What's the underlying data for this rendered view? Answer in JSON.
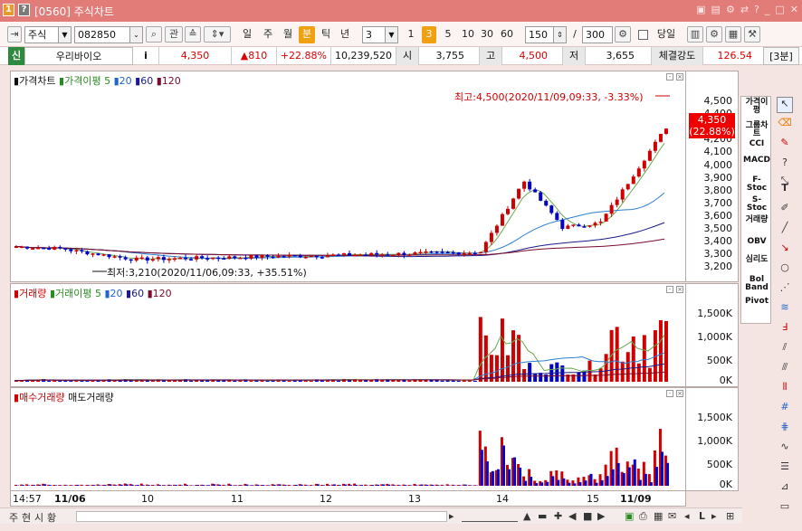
{
  "window": {
    "badge1": "1",
    "badge2": "?",
    "title": "[0560] 주식차트"
  },
  "toolbar": {
    "market_type": "주식",
    "stock_code": "082850",
    "btn_gwan": "관",
    "periods": [
      "일",
      "주",
      "월",
      "분",
      "틱",
      "년"
    ],
    "period_selected": "분",
    "interval_value": "3",
    "intervals": [
      "1",
      "3",
      "5",
      "10",
      "30",
      "60"
    ],
    "interval_selected": "3",
    "count": "150",
    "slash": "/",
    "max_count": "300",
    "today_label": "당일"
  },
  "infobar": {
    "market_badge": "신",
    "stock_name": "우리바이오",
    "info_icon": "i",
    "price": "4,350",
    "change": "▲810",
    "change_pct": "+22.88%",
    "volume": "10,239,520",
    "open_label": "시",
    "open": "3,755",
    "high_label": "고",
    "high": "4,500",
    "low_label": "저",
    "low": "3,655",
    "strength_label": "체결강도",
    "strength": "126.54",
    "interval_badge": "[3분]"
  },
  "price_pane": {
    "legend_title": "가격차트",
    "legend_ma": "가격이평",
    "ma_periods": [
      "5",
      "20",
      "60",
      "120"
    ],
    "high_annotation": "최고:4,500(2020/11/09,09:33, -3.33%)",
    "low_annotation": "최저:3,210(2020/11/06,09:33, +35.51%)",
    "current_price": "4,350",
    "current_pct": "(22.88%)",
    "y_labels": [
      "4,500",
      "4,400",
      "4,300",
      "4,200",
      "4,100",
      "4,000",
      "3,900",
      "3,800",
      "3,700",
      "3,600",
      "3,500",
      "3,400",
      "3,300",
      "3,200"
    ]
  },
  "volume_pane": {
    "legend_title": "거래량",
    "legend_ma": "거래이평",
    "ma_periods": [
      "5",
      "20",
      "60",
      "120"
    ],
    "y_labels": [
      "1,500K",
      "1,000K",
      "500K",
      "0K"
    ]
  },
  "buysell_pane": {
    "legend_buy": "매수거래량",
    "legend_sell": "매도거래량",
    "y_labels": [
      "1,500K",
      "1,000K",
      "500K",
      "0K"
    ]
  },
  "x_axis": {
    "labels": [
      {
        "text": "14:57",
        "bold": false
      },
      {
        "text": "11/06",
        "bold": true
      },
      {
        "text": "10",
        "bold": false
      },
      {
        "text": "11",
        "bold": false
      },
      {
        "text": "12",
        "bold": false
      },
      {
        "text": "13",
        "bold": false
      },
      {
        "text": "14",
        "bold": false
      },
      {
        "text": "15",
        "bold": false
      },
      {
        "text": "11/09",
        "bold": true
      }
    ]
  },
  "right_sidebar": [
    "가격이평",
    "그룹차트",
    "CCI",
    "MACD",
    "F-Stoc",
    "S-Stoc",
    "거래량",
    "OBV",
    "심리도",
    "Bol Band",
    "Pivot"
  ],
  "bottom": {
    "tabs": [
      "주",
      "현",
      "시",
      "황"
    ]
  },
  "colors": {
    "up": "#d00000",
    "down": "#0000cc",
    "ma5": "#6aa84f",
    "ma20": "#2a7fd4",
    "ma60": "#1a1a8a",
    "ma120": "#7a0a2a",
    "title": "#e27c79"
  }
}
